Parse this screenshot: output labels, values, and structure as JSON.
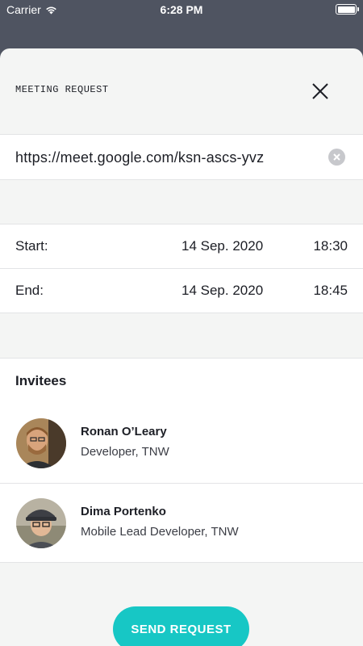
{
  "status_bar": {
    "carrier": "Carrier",
    "time": "6:28 PM",
    "battery_level": 1.0
  },
  "header": {
    "title": "MEETING REQUEST",
    "close_icon": "close-icon"
  },
  "meeting": {
    "url": "https://meet.google.com/ksn-ascs-yvz",
    "clear_icon": "clear-circle-icon"
  },
  "schedule": {
    "start": {
      "label": "Start:",
      "date": "14 Sep. 2020",
      "time": "18:30"
    },
    "end": {
      "label": "End:",
      "date": "14 Sep. 2020",
      "time": "18:45"
    }
  },
  "invitees": {
    "title": "Invitees",
    "items": [
      {
        "name": "Ronan O’Leary",
        "role": "Developer, TNW"
      },
      {
        "name": "Dima Portenko",
        "role": "Mobile Lead Developer, TNW"
      }
    ]
  },
  "actions": {
    "send_label": "SEND REQUEST"
  },
  "colors": {
    "accent": "#17c7c5",
    "backdrop": "#4f5461",
    "sheet": "#f4f5f4"
  }
}
